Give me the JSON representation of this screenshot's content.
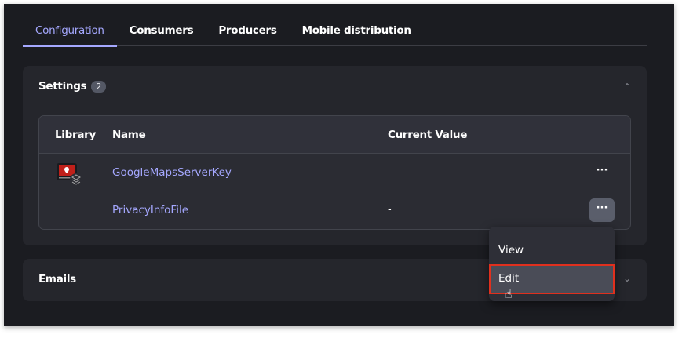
{
  "tabs": [
    {
      "label": "Configuration",
      "active": true
    },
    {
      "label": "Consumers"
    },
    {
      "label": "Producers"
    },
    {
      "label": "Mobile distribution"
    }
  ],
  "settings": {
    "title": "Settings",
    "count": "2",
    "columns": [
      "Library",
      "Name",
      "Current Value"
    ],
    "rows": [
      {
        "icon": "library-map-icon",
        "name": "GoogleMapsServerKey",
        "value": "",
        "menu": "···"
      },
      {
        "name": "PrivacyInfoFile",
        "value": "-",
        "menu": "···"
      }
    ]
  },
  "emails": {
    "title": "Emails"
  },
  "menu": {
    "items": [
      "View",
      "Edit"
    ]
  },
  "colors": {
    "accent": "#a5a8ff",
    "highlight": "#e0301e"
  }
}
